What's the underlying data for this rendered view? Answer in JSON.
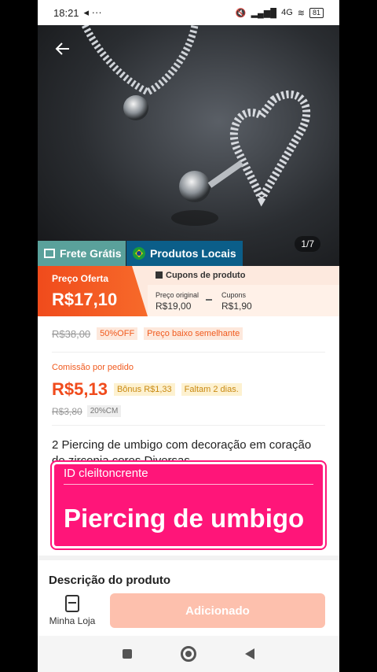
{
  "status": {
    "time": "18:21",
    "extras": "◂ ···",
    "signal": "4G",
    "battery": "81"
  },
  "hero": {
    "page_indicator": "1/7"
  },
  "badges": {
    "frete": "Frete Grátis",
    "locais": "Produtos Locais"
  },
  "price": {
    "offer_label": "Preço Oferta",
    "offer_value": "R$17,10",
    "coupons_header": "Cupons de produto",
    "original_label": "Preço original",
    "original_value": "R$19,00",
    "coupons_label": "Cupons",
    "coupons_value": "R$1,90"
  },
  "discount": {
    "old_price": "R$38,00",
    "off": "50%OFF",
    "low_price_tag": "Preço baixo semelhante"
  },
  "commission": {
    "label": "Comissão por pedido",
    "value": "R$5,13",
    "bonus": "Bônus R$1,33",
    "days": "Faltam 2 dias.",
    "old_value": "R$3,80",
    "cm_tag": "20%CM"
  },
  "product": {
    "title": "2 Piercing de umbigo com decoração em coração de zirconia cores Diversas"
  },
  "overlay": {
    "id_label": "ID  cleiltoncrente",
    "headline": "Piercing de umbigo"
  },
  "description": {
    "heading": "Descrição do produto"
  },
  "bottom": {
    "store_label": "Minha Loja",
    "add_button": "Adicionado"
  },
  "colors": {
    "accent": "#f04b1c",
    "overlay": "#ff1579",
    "frete": "#5aa19b",
    "locais": "#0b5e89"
  }
}
